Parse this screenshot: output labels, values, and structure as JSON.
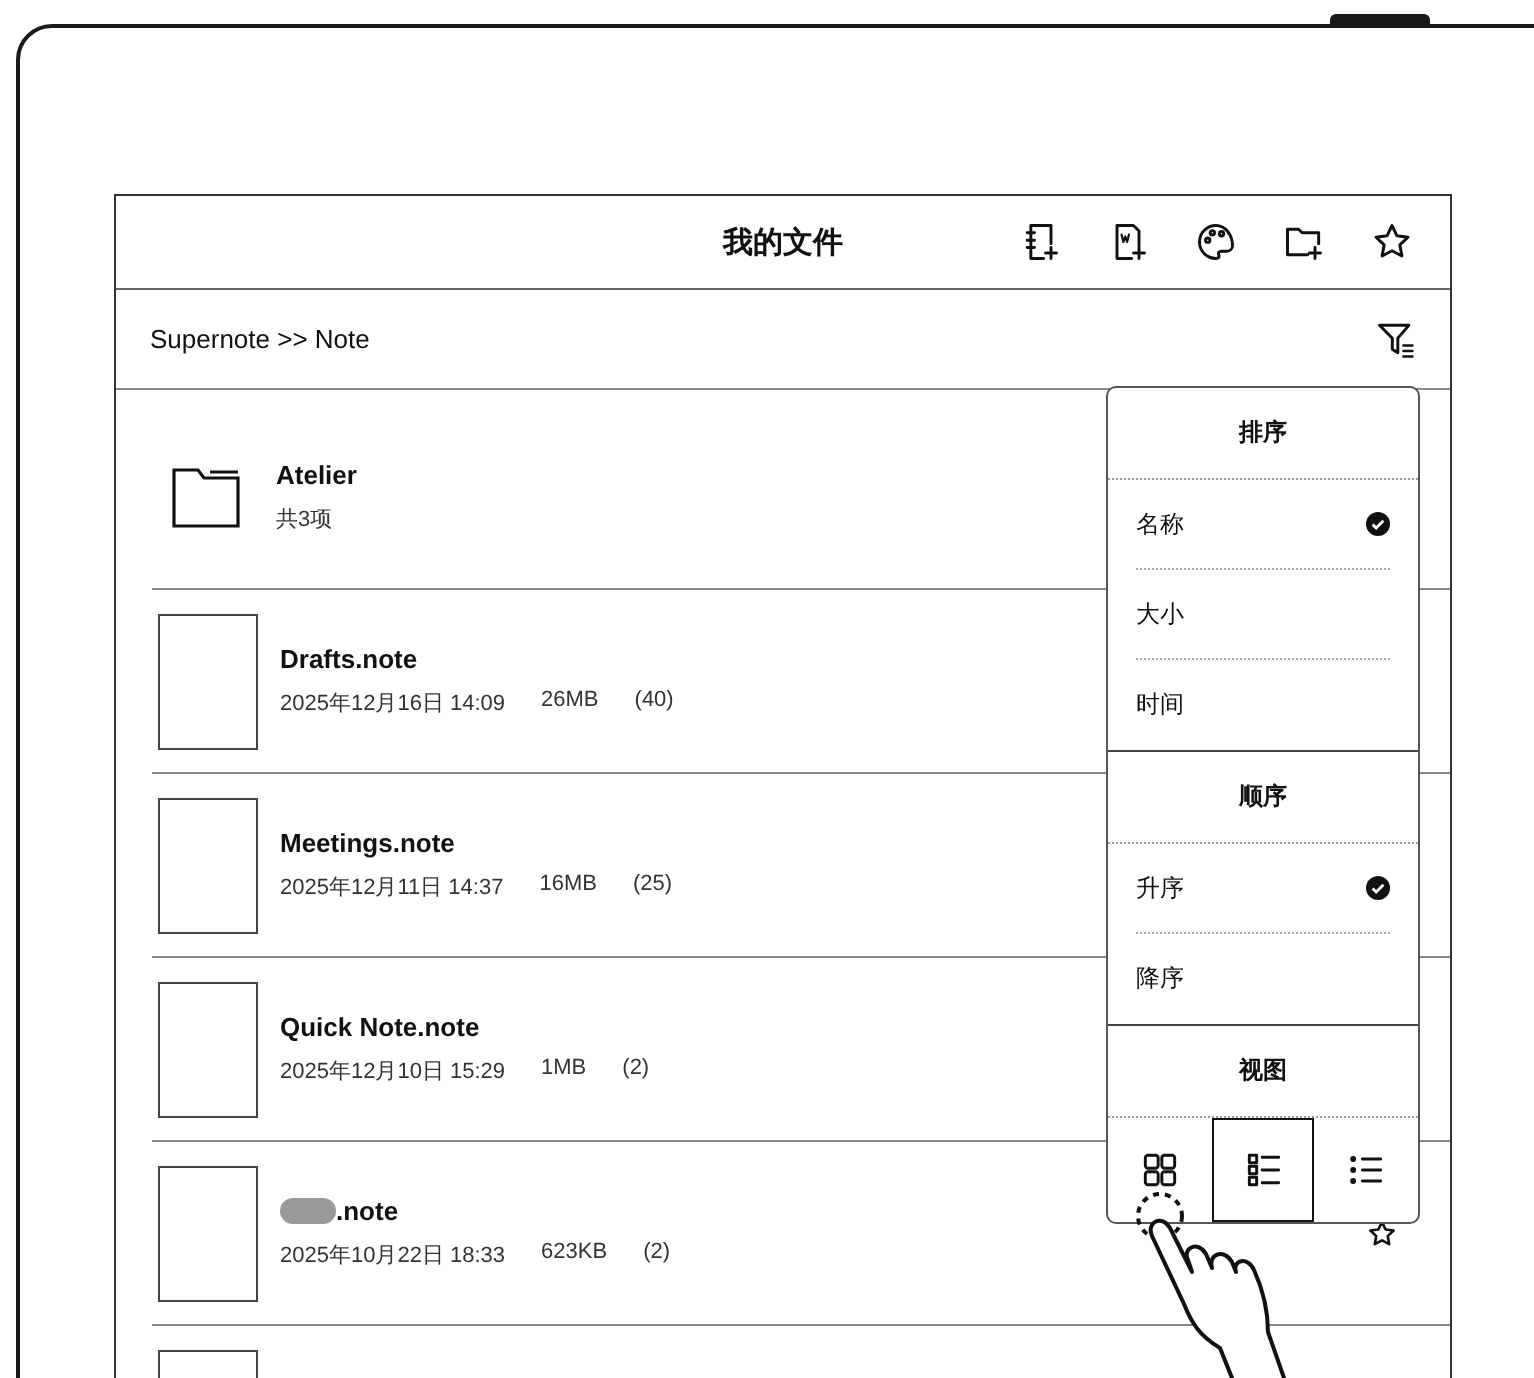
{
  "header": {
    "title": "我的文件"
  },
  "breadcrumb": "Supernote >> Note",
  "rows": [
    {
      "kind": "folder",
      "name": "Atelier",
      "meta": [
        "共3项"
      ]
    },
    {
      "kind": "file",
      "name": "Drafts.note",
      "meta": [
        "2025年12月16日 14:09",
        "26MB",
        "(40)"
      ]
    },
    {
      "kind": "file",
      "name": "Meetings.note",
      "meta": [
        "2025年12月11日 14:37",
        "16MB",
        "(25)"
      ]
    },
    {
      "kind": "file",
      "name": "Quick Note.note",
      "meta": [
        "2025年12月10日 15:29",
        "1MB",
        "(2)"
      ]
    },
    {
      "kind": "file",
      "name": ".note",
      "redacted": true,
      "star": true,
      "meta": [
        "2025年10月22日 18:33",
        "623KB",
        "(2)"
      ]
    },
    {
      "kind": "cutoff"
    }
  ],
  "menu": {
    "sections": [
      {
        "title": "排序",
        "items": [
          {
            "label": "名称",
            "selected": true
          },
          {
            "label": "大小",
            "selected": false
          },
          {
            "label": "时间",
            "selected": false
          }
        ]
      },
      {
        "title": "顺序",
        "items": [
          {
            "label": "升序",
            "selected": true
          },
          {
            "label": "降序",
            "selected": false
          }
        ]
      },
      {
        "title": "视图",
        "views": [
          {
            "kind": "grid",
            "selected": false
          },
          {
            "kind": "detail",
            "selected": true
          },
          {
            "kind": "list",
            "selected": false
          }
        ]
      }
    ]
  }
}
